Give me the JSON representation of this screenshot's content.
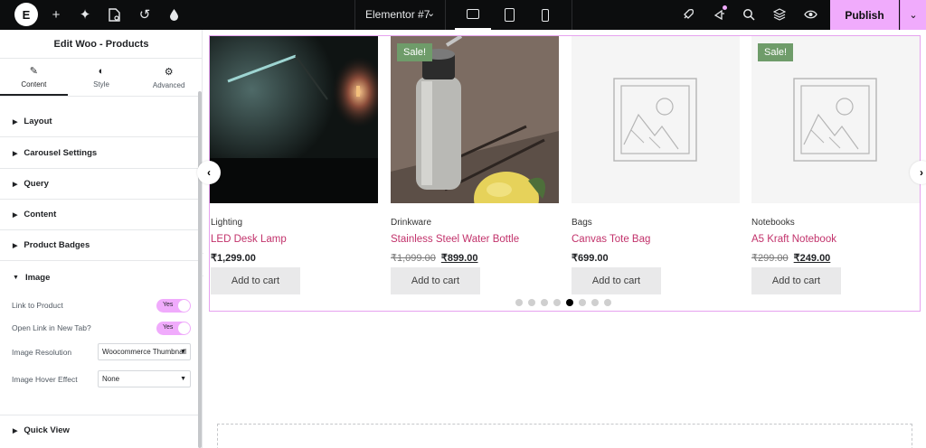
{
  "topbar": {
    "title": "Elementor #7",
    "publish_label": "Publish"
  },
  "panel": {
    "title": "Edit Woo - Products",
    "tabs": [
      {
        "label": "Content",
        "icon": "pencil-icon"
      },
      {
        "label": "Style",
        "icon": "half-circle-icon"
      },
      {
        "label": "Advanced",
        "icon": "gear-icon"
      }
    ],
    "sections": {
      "layout": "Layout",
      "carousel": "Carousel Settings",
      "query": "Query",
      "content": "Content",
      "badges": "Product Badges",
      "image": "Image",
      "quick_view": "Quick View"
    },
    "controls": {
      "link_to_product": {
        "label": "Link to Product",
        "value": "Yes"
      },
      "open_new_tab": {
        "label": "Open Link in New Tab?",
        "value": "Yes"
      },
      "image_resolution": {
        "label": "Image Resolution",
        "value": "Woocommerce Thumbnail"
      },
      "hover_effect": {
        "label": "Image Hover Effect",
        "value": "None"
      }
    }
  },
  "products": [
    {
      "category": "Lighting",
      "name": "LED Desk Lamp",
      "old_price": "",
      "price": "₹1,299.00",
      "sale": "",
      "button": "Add to cart"
    },
    {
      "category": "Drinkware",
      "name": "Stainless Steel Water Bottle",
      "old_price": "₹1,099.00",
      "price": "₹899.00",
      "sale": "Sale!",
      "button": "Add to cart"
    },
    {
      "category": "Bags",
      "name": "Canvas Tote Bag",
      "old_price": "",
      "price": "₹699.00",
      "sale": "",
      "button": "Add to cart"
    },
    {
      "category": "Notebooks",
      "name": "A5 Kraft Notebook",
      "old_price": "₹299.00",
      "price": "₹249.00",
      "sale": "Sale!",
      "button": "Add to cart"
    }
  ],
  "carousel": {
    "dot_count": 8,
    "active_dot": 5
  },
  "colors": {
    "accent": "#f0abfc",
    "product_link": "#c2326b",
    "sale_badge": "#6f9c6a",
    "topbar": "#0c0d0e"
  }
}
